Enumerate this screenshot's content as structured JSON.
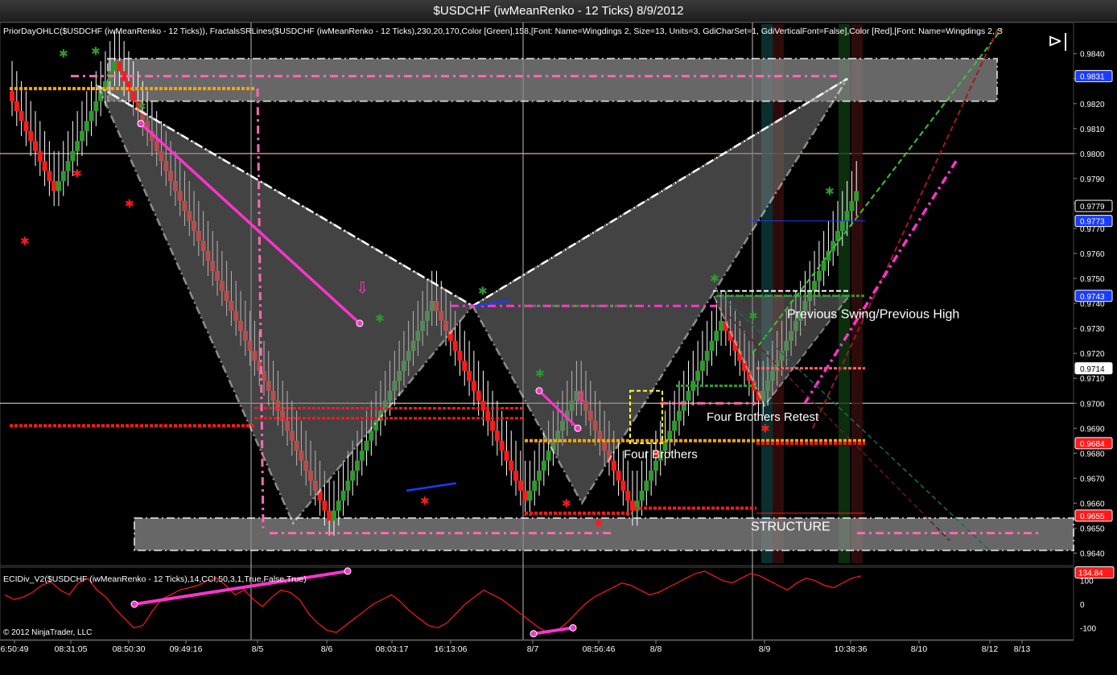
{
  "window": {
    "title": "$USDCHF (iwMeanRenko - 12 Ticks)  8/9/2012"
  },
  "indicators": {
    "main_label": "PriorDayOHLC($USDCHF (iwMeanRenko - 12 Ticks)), FractalsSRLines($USDCHF (iwMeanRenko - 12 Ticks),230,20,170,Color [Green],158,[Font: Name=Wingdings 2, Size=13, Units=3, GdiCharSet=1, GdiVerticalFont=False],Color [Red],[Font: Name=Wingdings 2, S",
    "sub_label": "ECIDiv_V2($USDCHF (iwMeanRenko - 12 Ticks),14,CCI,50,3,1,True,False,True)"
  },
  "copyright": "© 2012 NinjaTrader, LLC",
  "colors": {
    "up": "#2e9a2e",
    "down": "#ff1a1a",
    "pattern": "#ffffff",
    "magenta": "#ff33cc",
    "pink": "#ff69b4",
    "orange": "#ffa500",
    "tan": "#d2b48c"
  },
  "chart_data": {
    "type": "renko",
    "symbol": "$USDCHF",
    "ylim": [
      0.9635,
      0.9847
    ],
    "y_ticks": [
      "0.9840",
      "0.9830",
      "0.9820",
      "0.9810",
      "0.9800",
      "0.9790",
      "0.9780",
      "0.9770",
      "0.9760",
      "0.9750",
      "0.9740",
      "0.9730",
      "0.9720",
      "0.9710",
      "0.9700",
      "0.9690",
      "0.9680",
      "0.9670",
      "0.9660",
      "0.9650",
      "0.9640"
    ],
    "x_ticks": [
      "6:50:49",
      "08:31:05",
      "08:50:30",
      "09:49:16",
      "8/5",
      "8/6",
      "08:03:17",
      "16:13:06",
      "8/7",
      "08:56:46",
      "8/8",
      "8/9",
      "10:38:36",
      "8/10",
      "8/12",
      "8/13"
    ],
    "price_flags": [
      {
        "value": "0.9831",
        "color": "#1a3cff"
      },
      {
        "value": "0.9779",
        "color": "#000000"
      },
      {
        "value": "0.9773",
        "color": "#1a3cff"
      },
      {
        "value": "0.9743",
        "color": "#1a3cff"
      },
      {
        "value": "0.9714",
        "color": "#ffffff"
      },
      {
        "value": "0.9684",
        "color": "#ff1a1a"
      },
      {
        "value": "0.9655",
        "color": "#ff1a1a"
      }
    ],
    "swing_points": [
      0.9825,
      0.9785,
      0.9835,
      0.9655,
      0.974,
      0.9664,
      0.9705,
      0.966,
      0.973,
      0.9726,
      0.9703,
      0.9773,
      0.9785
    ],
    "pattern_points": [
      {
        "x": 11,
        "y": 0.9827
      },
      {
        "x": 36,
        "y": 0.9652
      },
      {
        "x": 59,
        "y": 0.9739
      },
      {
        "x": 73,
        "y": 0.966
      },
      {
        "x": 107,
        "y": 0.983
      }
    ],
    "annotations": [
      "Previous Swing/Previous High",
      "Four Brothers Retest",
      "Four Brothers",
      "STRUCTURE"
    ],
    "sub_ylim": [
      -150,
      150
    ],
    "sub_y_ticks": [
      "100",
      "0",
      "-100"
    ],
    "sub_flag": "134.84"
  }
}
